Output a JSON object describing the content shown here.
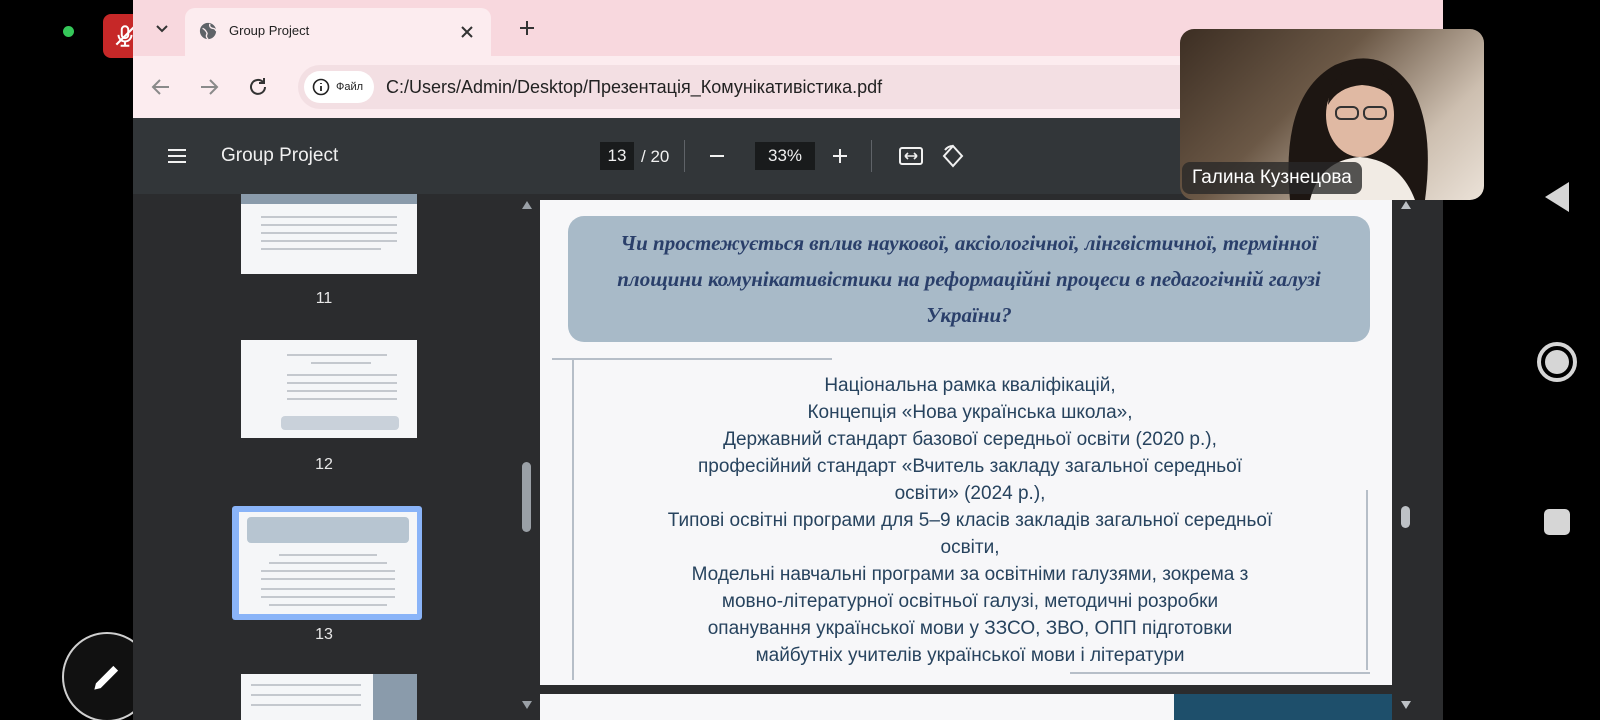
{
  "browser": {
    "tab_title": "Group Project",
    "site_chip_label": "Файл",
    "url": "C:/Users/Admin/Desktop/Презентація_Комунікативістика.pdf"
  },
  "pdf_toolbar": {
    "doc_title": "Group Project",
    "current_page": "13",
    "page_total": "/ 20",
    "zoom": "33%"
  },
  "sidebar": {
    "thumbnails": [
      {
        "label": "11"
      },
      {
        "label": "12"
      },
      {
        "label": "13",
        "selected": true
      }
    ]
  },
  "slide": {
    "question": "Чи простежується вплив наукової, аксіологічної, лінгвістичної, термінної площини комунікативістики на реформаційні процеси в педагогічній галузі України?",
    "lines": [
      "Національна рамка кваліфікацій,",
      "Концепція «Нова українська школа»,",
      "Державний стандарт базової середньої освіти (2020 р.),",
      "професійний стандарт «Вчитель закладу загальної середньої",
      "освіти» (2024 р.),",
      "Типові освітні програми для 5–9 класів закладів загальної середньої",
      "освіти,",
      "Модельні навчальні програми за освітніми галузями, зокрема з",
      "мовно-літературної освітньої галузі, методичні розробки",
      "опанування української мови у ЗЗСО, ЗВО, ОПП підготовки",
      "майбутніх учителів української мови і літератури"
    ]
  },
  "video": {
    "participant_name": "Галина Кузнецова"
  },
  "colors": {
    "mic_muted": "#c62828",
    "pdf_toolbar": "#323639",
    "question_box": "#a8bac8",
    "slide_text": "#27435e"
  }
}
